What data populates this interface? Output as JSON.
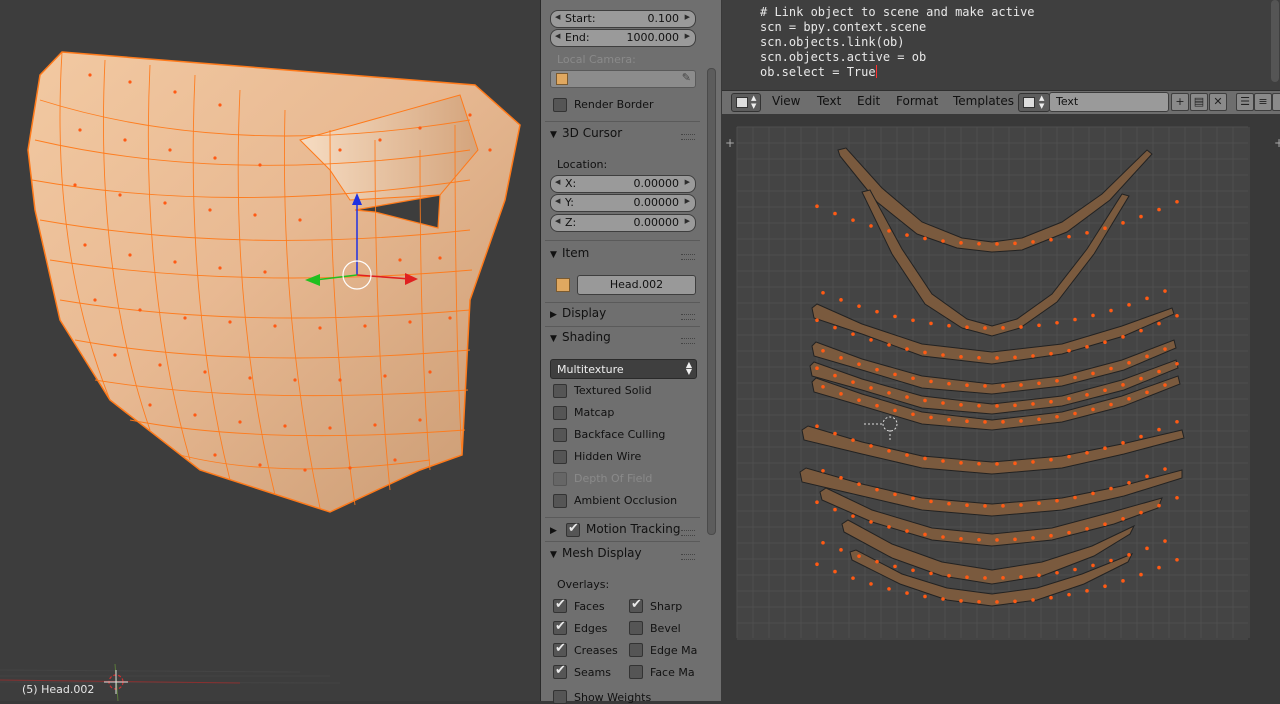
{
  "viewport": {
    "object_label": "(5) Head.002"
  },
  "properties": {
    "clip": {
      "start_label": "Start:",
      "start_value": "0.100",
      "end_label": "End:",
      "end_value": "1000.000"
    },
    "local_camera_label": "Local Camera:",
    "render_border_label": "Render Border",
    "cursor_panel": {
      "title": "3D Cursor",
      "location_label": "Location:",
      "x_label": "X:",
      "x_value": "0.00000",
      "y_label": "Y:",
      "y_value": "0.00000",
      "z_label": "Z:",
      "z_value": "0.00000"
    },
    "item_panel": {
      "title": "Item",
      "name_value": "Head.002"
    },
    "display_panel": {
      "title": "Display"
    },
    "shading_panel": {
      "title": "Shading",
      "mode": "Multitexture",
      "options": [
        {
          "label": "Textured Solid",
          "checked": false,
          "enabled": true
        },
        {
          "label": "Matcap",
          "checked": false,
          "enabled": true
        },
        {
          "label": "Backface Culling",
          "checked": false,
          "enabled": true
        },
        {
          "label": "Hidden Wire",
          "checked": false,
          "enabled": true
        },
        {
          "label": "Depth Of Field",
          "checked": false,
          "enabled": false
        },
        {
          "label": "Ambient Occlusion",
          "checked": false,
          "enabled": true
        }
      ]
    },
    "motion_tracking_panel": {
      "title": "Motion Tracking",
      "checked": true
    },
    "mesh_display_panel": {
      "title": "Mesh Display",
      "overlays_label": "Overlays:",
      "left_column": [
        {
          "label": "Faces",
          "checked": true
        },
        {
          "label": "Edges",
          "checked": true
        },
        {
          "label": "Creases",
          "checked": true
        },
        {
          "label": "Seams",
          "checked": true
        }
      ],
      "right_column": [
        {
          "label": "Sharp",
          "checked": true
        },
        {
          "label": "Bevel",
          "checked": false
        },
        {
          "label": "Edge Ma",
          "checked": false
        },
        {
          "label": "Face Ma",
          "checked": false
        }
      ],
      "show_weights_label": "Show Weights"
    }
  },
  "text_editor": {
    "code_lines": [
      "# Link object to scene and make active",
      "scn = bpy.context.scene",
      "scn.objects.link(ob)",
      "scn.objects.active = ob",
      "ob.select = True"
    ]
  },
  "header": {
    "menus": [
      "View",
      "Text",
      "Edit",
      "Format",
      "Templates"
    ],
    "text_datablock": "Text"
  },
  "colors": {
    "accent": "#ff7a1a",
    "vertex": "#ff5a14",
    "face": "#7a5a3e"
  }
}
